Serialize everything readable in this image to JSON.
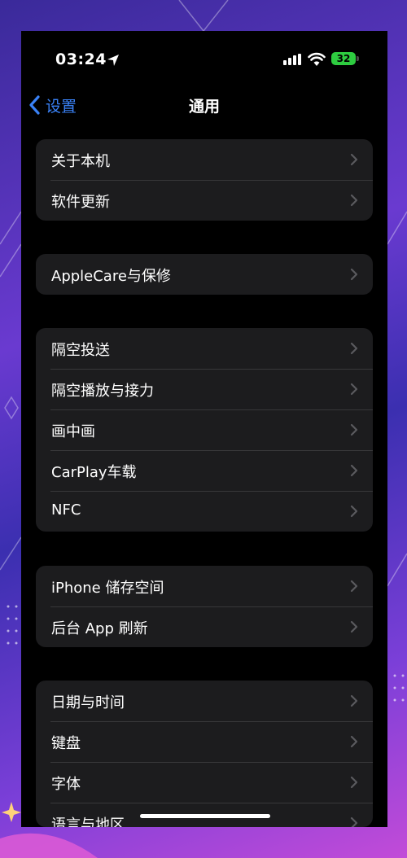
{
  "status_bar": {
    "time": "03:24",
    "battery": "32"
  },
  "nav": {
    "back_label": "设置",
    "title": "通用"
  },
  "groups": [
    {
      "items": [
        {
          "label": "关于本机"
        },
        {
          "label": "软件更新"
        }
      ]
    },
    {
      "items": [
        {
          "label": "AppleCare与保修"
        }
      ]
    },
    {
      "items": [
        {
          "label": "隔空投送"
        },
        {
          "label": "隔空播放与接力"
        },
        {
          "label": "画中画"
        },
        {
          "label": "CarPlay车载"
        },
        {
          "label": "NFC"
        }
      ]
    },
    {
      "items": [
        {
          "label": "iPhone 储存空间"
        },
        {
          "label": "后台 App 刷新"
        }
      ]
    },
    {
      "items": [
        {
          "label": "日期与时间"
        },
        {
          "label": "键盘"
        },
        {
          "label": "字体"
        },
        {
          "label": "语言与地区"
        }
      ]
    }
  ],
  "colors": {
    "accent": "#3a82f7",
    "background": "#000000",
    "group_bg": "#1c1c1e",
    "battery": "#2ecc40"
  }
}
